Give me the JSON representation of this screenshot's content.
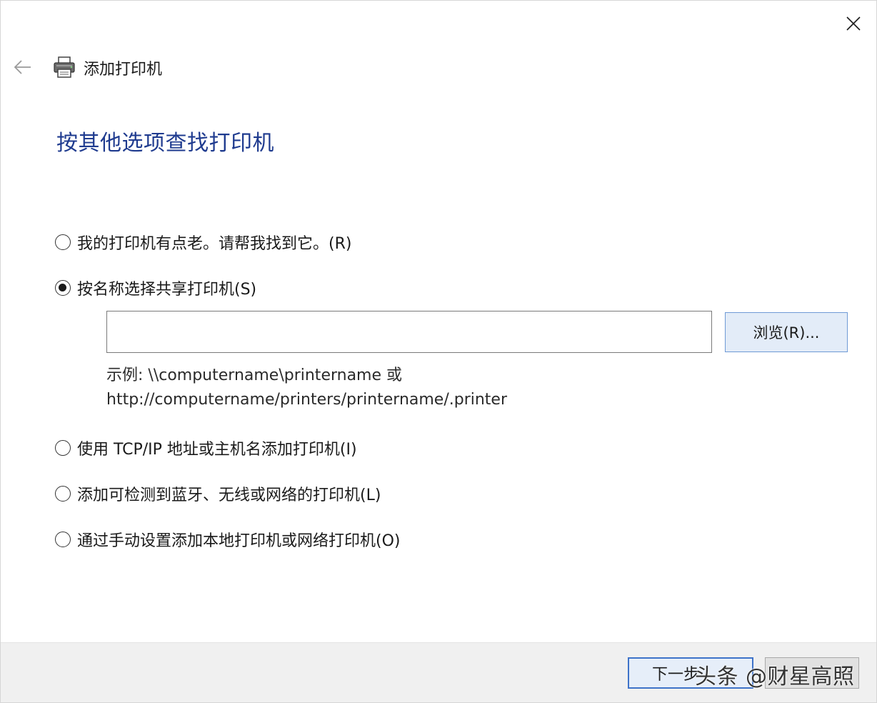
{
  "window": {
    "title": "添加打印机",
    "close_icon": "close-icon",
    "back_icon": "back-arrow-icon",
    "title_icon": "printer-icon"
  },
  "heading": "按其他选项查找打印机",
  "options": [
    {
      "label": "我的打印机有点老。请帮我找到它。(R)",
      "selected": false
    },
    {
      "label": "按名称选择共享打印机(S)",
      "selected": true
    },
    {
      "label": "使用 TCP/IP 地址或主机名添加打印机(I)",
      "selected": false
    },
    {
      "label": "添加可检测到蓝牙、无线或网络的打印机(L)",
      "selected": false
    },
    {
      "label": "通过手动设置添加本地打印机或网络打印机(O)",
      "selected": false
    }
  ],
  "shared_printer": {
    "input_value": "",
    "browse_label": "浏览(R)...",
    "example_line1": "示例: \\\\computername\\printername 或",
    "example_line2": "http://computername/printers/printername/.printer"
  },
  "footer": {
    "next_label": "下一步",
    "cancel_label": ""
  },
  "watermark": "头条 @财星高照",
  "colors": {
    "heading": "#1f3b8f",
    "footer_bg": "#f0f0f0",
    "primary_border": "#3e73c9",
    "browse_bg": "#e3ecf8"
  }
}
